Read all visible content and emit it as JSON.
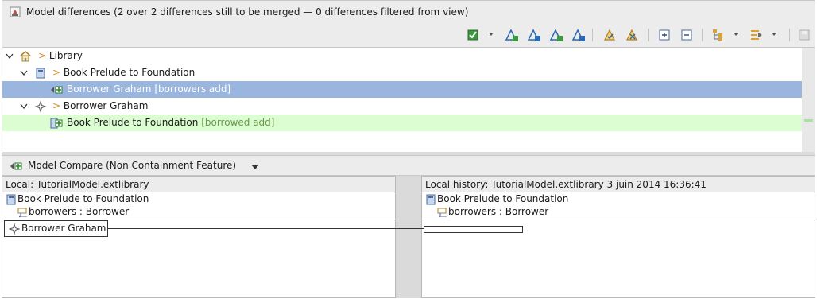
{
  "view": {
    "title": "Model differences  (2 over 2 differences still to be merged — 0 differences filtered from view)",
    "icon": "model-differences-icon"
  },
  "toolbar": {
    "buttons": [
      "merge-accept-icon",
      "dropdown-arrow-icon",
      "next-diff-icon",
      "previous-diff-icon",
      "next-change-icon",
      "previous-change-icon",
      "accept-all-icon",
      "reject-all-icon",
      "expand-all-icon",
      "collapse-all-icon",
      "group-icon",
      "filter-icon",
      "save-icon"
    ]
  },
  "tree": {
    "rows": [
      {
        "marker": ">",
        "label": "Library",
        "extra": ""
      },
      {
        "marker": ">",
        "label": "Book Prelude to Foundation",
        "extra": ""
      },
      {
        "marker": "",
        "label": "Borrower Graham",
        "extra": "[borrowers add]"
      },
      {
        "marker": ">",
        "label": "Borrower Graham",
        "extra": ""
      },
      {
        "marker": "",
        "label": "Book Prelude to Foundation",
        "extra": "[borrowed add]"
      }
    ]
  },
  "compare": {
    "title": "Model Compare (Non Containment Feature)",
    "left": {
      "header": "Local: TutorialModel.extlibrary",
      "object": "Book Prelude to Foundation",
      "feature": "borrowers : Borrower",
      "value": "Borrower Graham"
    },
    "right": {
      "header": "Local history: TutorialModel.extlibrary 3 juin 2014 16:36:41",
      "object": "Book Prelude to Foundation",
      "feature": "borrowers : Borrower"
    }
  },
  "colors": {
    "selection": "#9ab6df",
    "addition": "#dcfdd2",
    "marker": "#e08a2a"
  }
}
